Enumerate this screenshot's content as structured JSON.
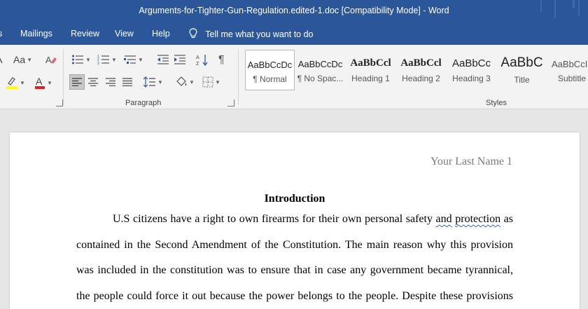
{
  "window": {
    "title": "Arguments-for-Tighter-Gun-Regulation.edited-1.doc [Compatibility Mode]  -  Word"
  },
  "menu": {
    "tabs": [
      {
        "label": "s"
      },
      {
        "label": "Mailings"
      },
      {
        "label": "Review"
      },
      {
        "label": "View"
      },
      {
        "label": "Help"
      }
    ],
    "tell_me": "Tell me what you want to do"
  },
  "ribbon": {
    "font_group": {
      "change_case": "Aa"
    },
    "paragraph_group": {
      "label": "Paragraph"
    },
    "styles_group": {
      "label": "Styles",
      "styles": [
        {
          "sample": "AaBbCcDc",
          "name": "¶ Normal",
          "selected": true
        },
        {
          "sample": "AaBbCcDc",
          "name": "¶ No Spac...",
          "selected": false
        },
        {
          "sample": "AaBbCcl",
          "name": "Heading 1",
          "selected": false
        },
        {
          "sample": "AaBbCcl",
          "name": "Heading 2",
          "selected": false
        },
        {
          "sample": "AaBbCc",
          "name": "Heading 3",
          "selected": false
        },
        {
          "sample": "AaBbC",
          "name": "Title",
          "selected": false
        },
        {
          "sample": "AaBbCcI",
          "name": "Subtitle",
          "selected": false
        }
      ]
    }
  },
  "colors": {
    "brand": "#2b579a",
    "highlight": "#ffff00",
    "font_color": "#e02020"
  },
  "document": {
    "header": "Your Last Name 1",
    "heading": "Introduction",
    "lines": [
      {
        "pre": "U.S citizens have a right to own firearms for their own personal safety ",
        "mark1": "and",
        "mid": " ",
        "mark2": " protection",
        "post": " as"
      },
      {
        "text": "contained in the Second Amendment of the Constitution. The main reason why this provision"
      },
      {
        "text": "was included in the constitution was to ensure that in case any government became tyrannical,"
      },
      {
        "text": "the people could force it out because the power belongs to the people. Despite these provisions"
      }
    ]
  }
}
